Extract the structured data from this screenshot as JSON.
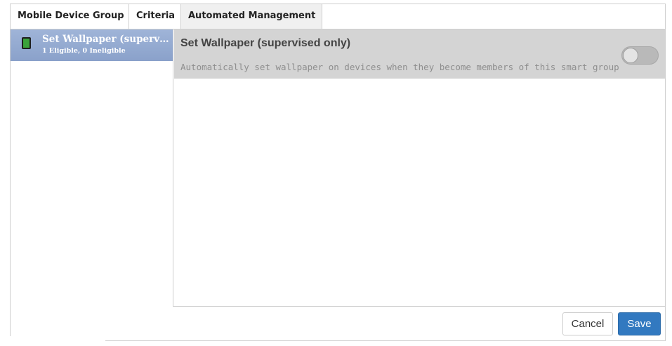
{
  "tabs": [
    {
      "label": "Mobile Device Group",
      "active": false
    },
    {
      "label": "Criteria",
      "active": false
    },
    {
      "label": "Automated Management",
      "active": true
    }
  ],
  "sidebar": {
    "items": [
      {
        "title": "Set Wallpaper (supervised only)",
        "subtitle": "1 Eligible, 0 Ineligible",
        "icon": "mobile-device-icon",
        "selected": true
      }
    ]
  },
  "detail": {
    "title": "Set Wallpaper (supervised only)",
    "description": "Automatically set wallpaper on devices when they become members of this smart group",
    "toggle_on": false
  },
  "footer": {
    "cancel_label": "Cancel",
    "save_label": "Save"
  },
  "colors": {
    "selected_item": "#8aa1ca",
    "primary_button": "#3279c0",
    "device_icon": "#3aa23a"
  }
}
